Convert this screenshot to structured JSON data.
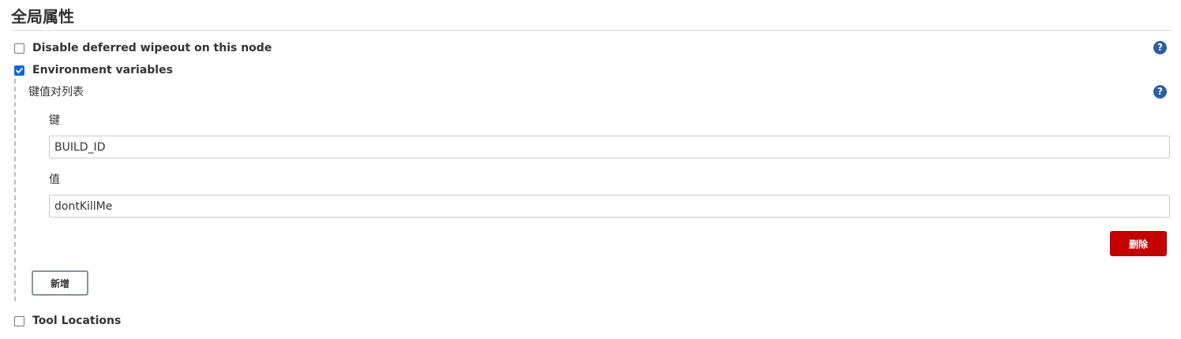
{
  "section": {
    "title": "全局属性"
  },
  "options": {
    "disable_wipeout": {
      "label": "Disable deferred wipeout on this node",
      "checked": false
    },
    "env_vars": {
      "label": "Environment variables",
      "checked": true
    },
    "tool_locations": {
      "label": "Tool Locations",
      "checked": false
    }
  },
  "env": {
    "list_label": "键值对列表",
    "key_label": "键",
    "key_value": "BUILD_ID",
    "value_label": "值",
    "value_value": "dontKillMe",
    "delete_label": "删除",
    "add_label": "新增"
  },
  "help": {
    "glyph": "?",
    "icon": "help-icon"
  },
  "colors": {
    "checkbox_accent": "#1565d8",
    "help_icon": "#2a5fa5",
    "delete_button": "#c40000",
    "dashed_guide": "#bdbdbd"
  }
}
